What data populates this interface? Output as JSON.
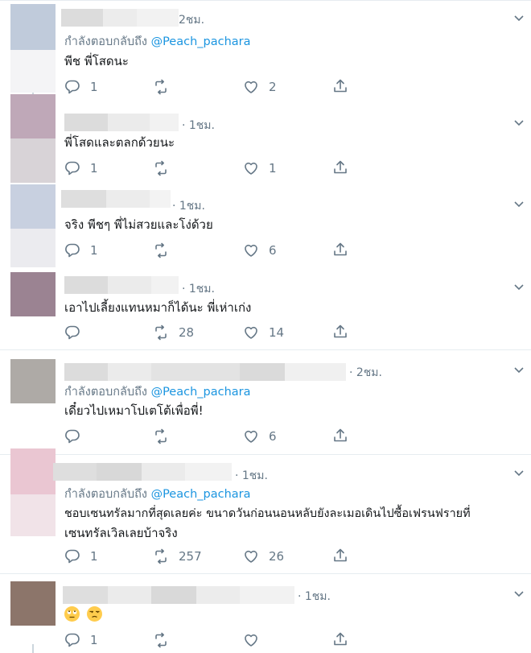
{
  "colors": {
    "accent": "#1b95e0",
    "muted": "#657786",
    "text": "#14171a",
    "separator": "#e6ecf0"
  },
  "tweets": [
    {
      "time": "2ชม.",
      "replying_prefix": "กำลังตอบกลับถึง",
      "replying_handle": "@Peach_pachara",
      "text": "พีช พี่โสดนะ",
      "replies": "1",
      "retweets": "",
      "likes": "2"
    },
    {
      "time": "· 1ชม.",
      "text": "พี่โสดและตลกด้วยนะ",
      "replies": "1",
      "retweets": "",
      "likes": "1"
    },
    {
      "time": "· 1ชม.",
      "text": "จริง พีชๆ พี่ไม่สวยและโง่ด้วย",
      "replies": "1",
      "retweets": "",
      "likes": "6"
    },
    {
      "time": "· 1ชม.",
      "text": "เอาไปเลี้ยงแทนหมาก็ได้นะ พี่เห่าเก่ง",
      "replies": "",
      "retweets": "28",
      "likes": "14"
    },
    {
      "time": "· 2ชม.",
      "replying_prefix": "กำลังตอบกลับถึง",
      "replying_handle": "@Peach_pachara",
      "text": "เดี๋ยวไปเหมาโปเตโต้เพื่อพี่!",
      "replies": "",
      "retweets": "",
      "likes": "6"
    },
    {
      "time": "· 1ชม.",
      "replying_prefix": "กำลังตอบกลับถึง",
      "replying_handle": "@Peach_pachara",
      "text_line1": "ชอบเซนทรัลมากที่สุดเลยค่ะ ขนาดวันก่อนนอนหลับยังละเมอเดินไปซื้อเฟรนฟรายที่",
      "text_line2": "เซนทรัลเวิลเลยบ้าจริง",
      "replies": "1",
      "retweets": "257",
      "likes": "26"
    },
    {
      "time": "· 1ชม.",
      "emoji_1": "face-with-rolling-eyes",
      "emoji_2": "unamused-face",
      "replies": "1",
      "retweets": "",
      "likes": ""
    }
  ],
  "icons": {
    "reply": "reply-icon",
    "retweet": "retweet-icon",
    "like": "heart-icon",
    "share": "share-icon",
    "caret": "chevron-down-icon"
  }
}
